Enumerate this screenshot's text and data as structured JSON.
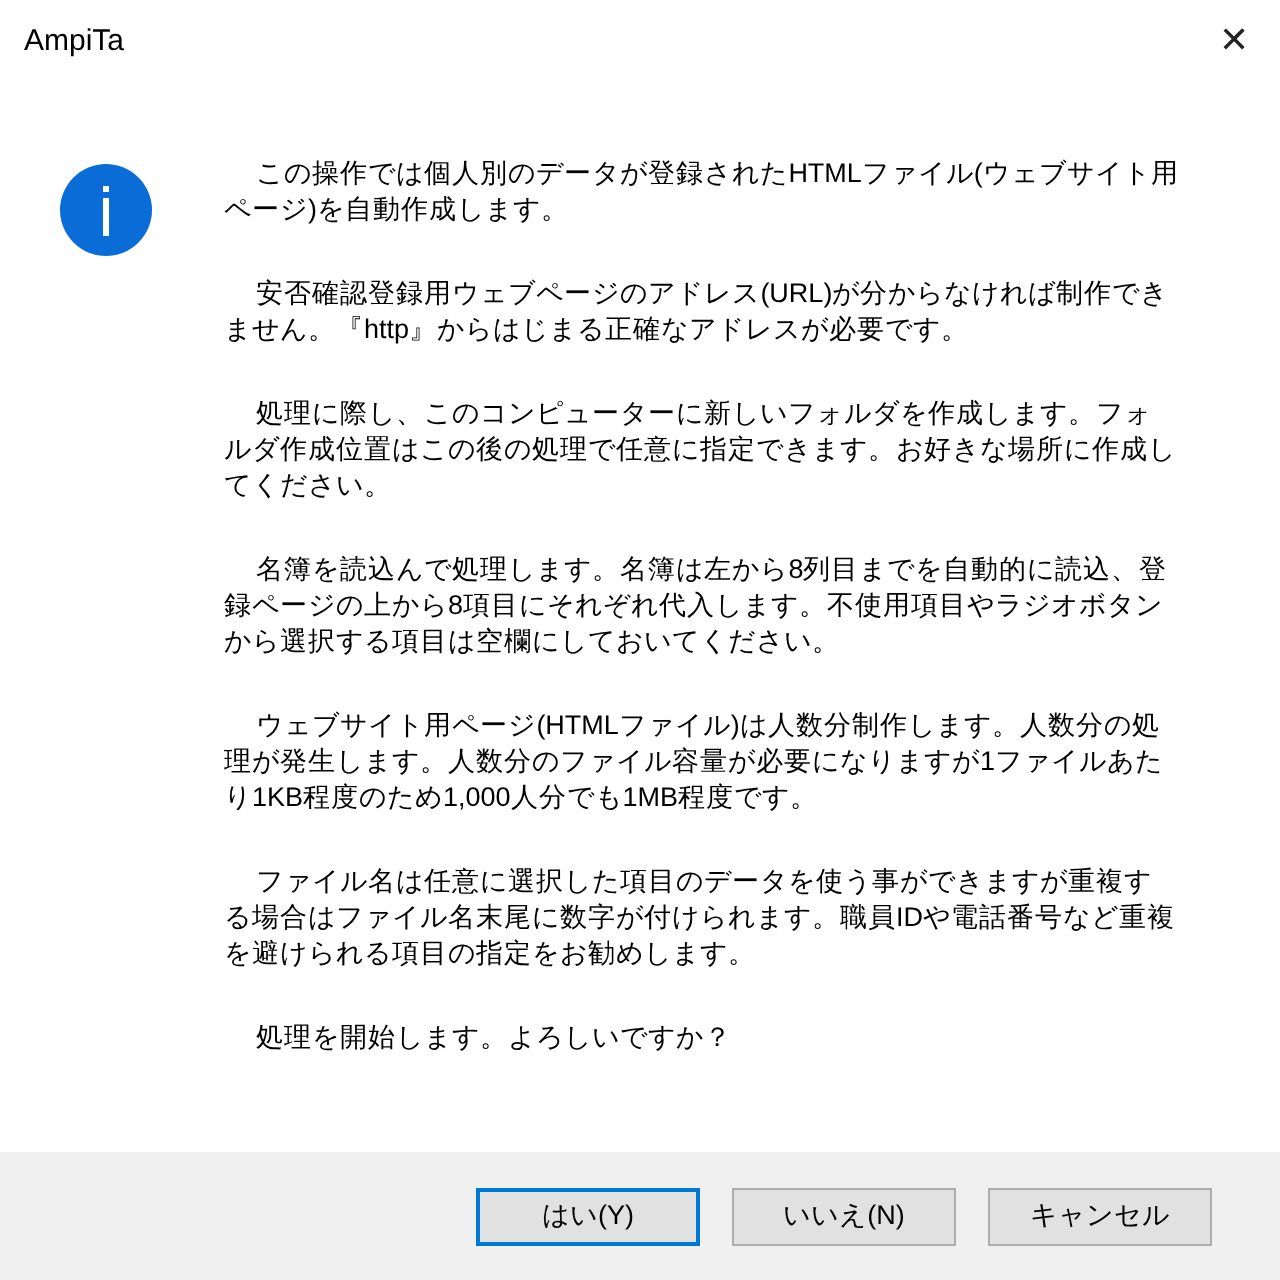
{
  "window": {
    "title": "AmpiTa",
    "close": "✕"
  },
  "message": {
    "paragraphs": [
      "この操作では個人別のデータが登録されたHTMLファイル(ウェブサイト用ページ)を自動作成します。",
      "安否確認登録用ウェブページのアドレス(URL)が分からなければ制作できません。『http』からはじまる正確なアドレスが必要です。",
      "処理に際し、このコンピューターに新しいフォルダを作成します。フォルダ作成位置はこの後の処理で任意に指定できます。お好きな場所に作成してください。",
      "名簿を読込んで処理します。名簿は左から8列目までを自動的に読込、登録ページの上から8項目にそれぞれ代入します。不使用項目やラジオボタンから選択する項目は空欄にしておいてください。",
      "ウェブサイト用ページ(HTMLファイル)は人数分制作します。人数分の処理が発生します。人数分のファイル容量が必要になりますが1ファイルあたり1KB程度のため1,000人分でも1MB程度です。",
      "ファイル名は任意に選択した項目のデータを使う事ができますが重複する場合はファイル名末尾に数字が付けられます。職員IDや電話番号など重複を避けられる項目の指定をお勧めします。",
      "処理を開始します。よろしいですか？"
    ]
  },
  "buttons": [
    {
      "label": "はい(Y)",
      "focused": true
    },
    {
      "label": "いいえ(N)",
      "focused": false
    },
    {
      "label": "キャンセル",
      "focused": false
    }
  ]
}
